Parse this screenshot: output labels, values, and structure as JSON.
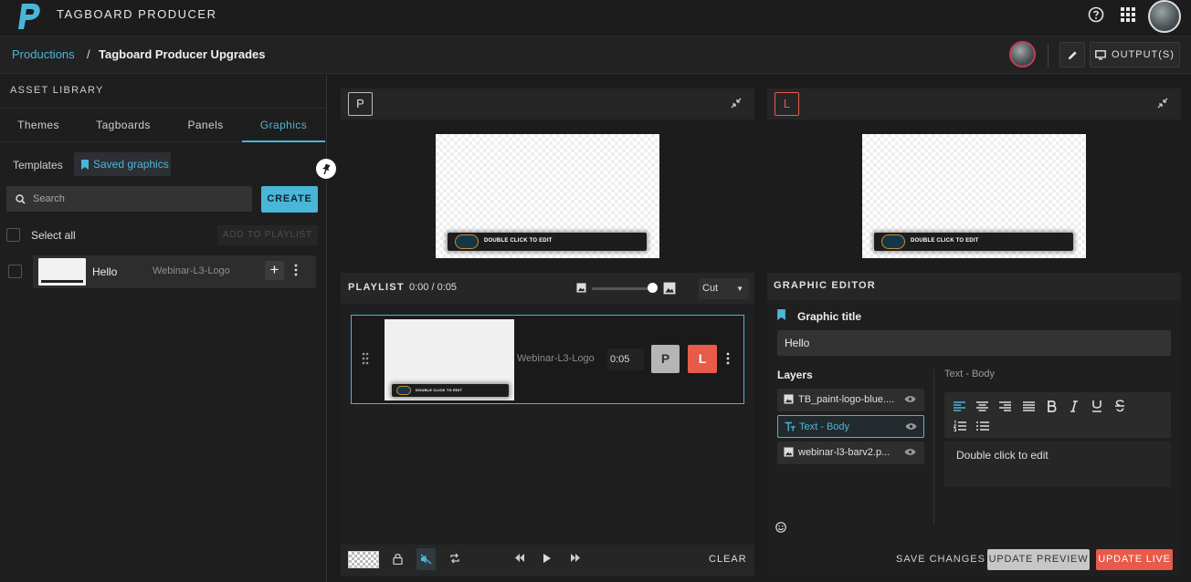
{
  "app": {
    "title": "TAGBOARD PRODUCER"
  },
  "breadcrumb": {
    "root": "Productions",
    "separator": "/",
    "current": "Tagboard Producer Upgrades"
  },
  "header": {
    "output_label": "OUTPUT(S)"
  },
  "asset_library": {
    "title": "ASSET LIBRARY",
    "tabs": [
      {
        "label": "Themes"
      },
      {
        "label": "Tagboards"
      },
      {
        "label": "Panels"
      },
      {
        "label": "Graphics",
        "active": true
      }
    ],
    "subtabs": {
      "templates": "Templates",
      "saved": "Saved graphics"
    },
    "search": {
      "placeholder": "Search"
    },
    "create_label": "CREATE",
    "select_all": "Select all",
    "add_to_playlist": "ADD TO PLAYLIST",
    "items": [
      {
        "name": "Hello",
        "template": "Webinar-L3-Logo"
      }
    ]
  },
  "preview": {
    "badge": "P",
    "lower_third": "DOUBLE CLICK TO EDIT"
  },
  "live": {
    "badge": "L",
    "lower_third": "DOUBLE CLICK TO EDIT"
  },
  "playlist": {
    "title": "PLAYLIST",
    "time": "0:00 / 0:05",
    "transition": "Cut",
    "items": [
      {
        "template": "Webinar-L3-Logo",
        "duration": "0:05",
        "p_label": "P",
        "l_label": "L",
        "lower_third": "DOUBLE CLICK TO EDIT"
      }
    ],
    "clear_label": "CLEAR"
  },
  "editor": {
    "title": "GRAPHIC EDITOR",
    "graphic_title_label": "Graphic title",
    "graphic_title_value": "Hello",
    "layers_label": "Layers",
    "layers": [
      {
        "name": "TB_paint-logo-blue....",
        "type": "image"
      },
      {
        "name": "Text - Body",
        "type": "text",
        "selected": true
      },
      {
        "name": "webinar-l3-barv2.p...",
        "type": "image"
      }
    ],
    "selected_layer_label": "Text - Body",
    "text_value": "Double click to edit",
    "save_label": "SAVE CHANGES",
    "update_preview_label": "UPDATE PREVIEW",
    "update_live_label": "UPDATE LIVE"
  },
  "colors": {
    "accent": "#49b6d8",
    "live": "#e85a4a",
    "background": "#1c1c1c"
  }
}
